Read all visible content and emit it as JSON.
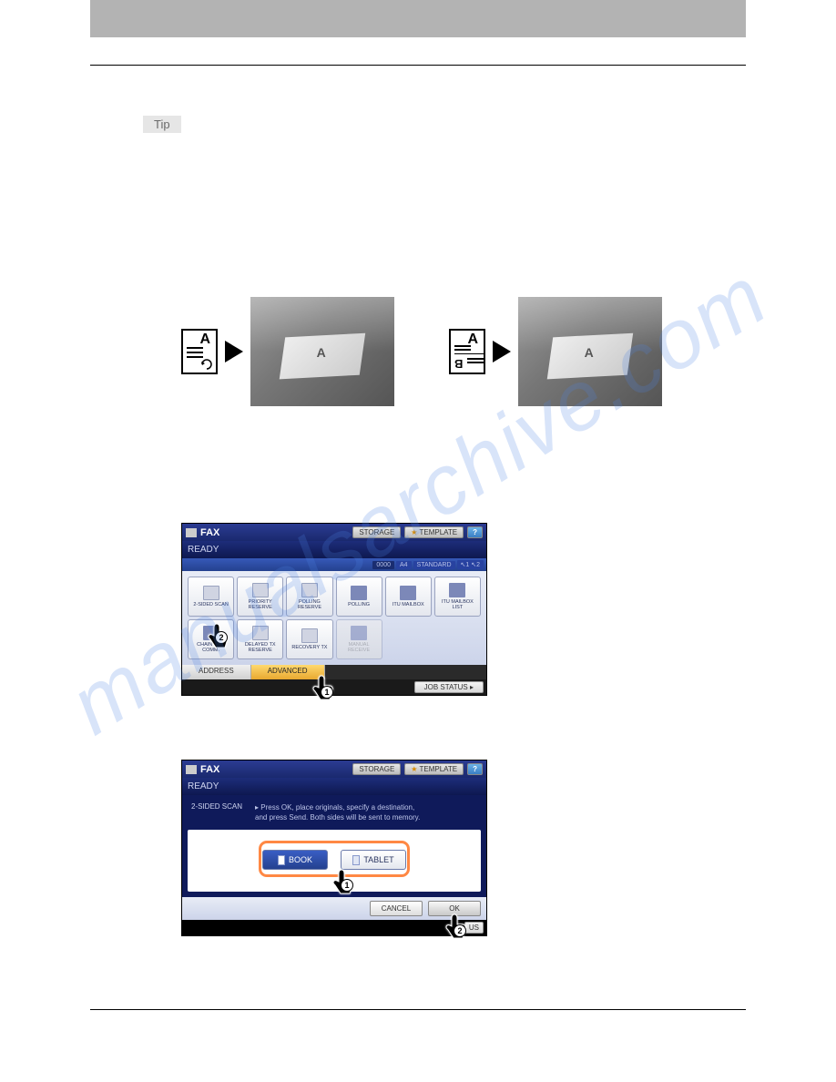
{
  "tip": "Tip",
  "diag_left_letter": "A",
  "diag_right_letter_top": "A",
  "diag_right_letter_bottom": "B",
  "feeder_letter": "A",
  "watermark": "manualsarchive.com",
  "screen1": {
    "title": "FAX",
    "storage": "STORAGE",
    "template": "TEMPLATE",
    "help": "?",
    "ready": "READY",
    "status_count": "0000",
    "status_size": "A4",
    "status_mode": "STANDARD",
    "status_line": "↖1 ↖2",
    "buttons": [
      {
        "label": "2-SIDED SCAN"
      },
      {
        "label": "PRIORITY RESERVE"
      },
      {
        "label": "POLLING RESERVE"
      },
      {
        "label": "POLLING"
      },
      {
        "label": "ITU MAILBOX"
      },
      {
        "label": "ITU MAILBOX LIST"
      },
      {
        "label": "CHAIN DIAL COMM."
      },
      {
        "label": "DELAYED TX RESERVE"
      },
      {
        "label": "RECOVERY TX"
      },
      {
        "label": "MANUAL RECEIVE",
        "dim": true
      }
    ],
    "tab_address": "ADDRESS",
    "tab_advanced": "ADVANCED",
    "job_status": "JOB STATUS",
    "hand1_num": "1",
    "hand2_num": "2"
  },
  "screen2": {
    "title": "FAX",
    "storage": "STORAGE",
    "template": "TEMPLATE",
    "help": "?",
    "ready": "READY",
    "mode_label": "2-SIDED SCAN",
    "instr_line1": "▸ Press OK, place originals, specify a destination,",
    "instr_line2": "and press Send. Both sides will be sent to memory.",
    "btn_book": "BOOK",
    "btn_tablet": "TABLET",
    "btn_cancel": "CANCEL",
    "btn_ok": "OK",
    "job_status_suffix": "US",
    "hand1_num": "1",
    "hand2_num": "2"
  }
}
